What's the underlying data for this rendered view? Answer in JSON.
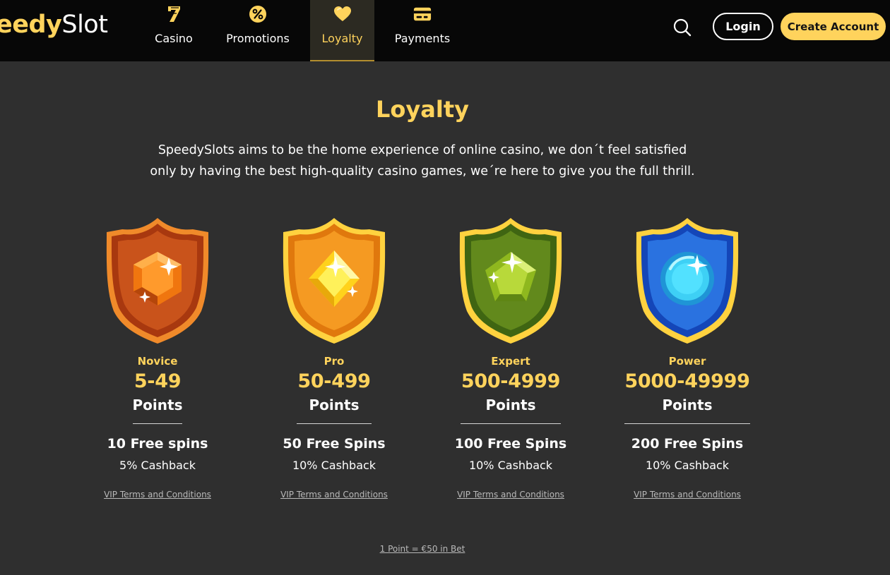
{
  "brand": {
    "logo_part1": "eedy",
    "logo_part2": "Slot"
  },
  "nav": [
    {
      "label": "Casino",
      "icon": "seven-icon"
    },
    {
      "label": "Promotions",
      "icon": "percent-icon"
    },
    {
      "label": "Loyalty",
      "icon": "heart-icon",
      "active": true
    },
    {
      "label": "Payments",
      "icon": "card-icon"
    }
  ],
  "header": {
    "login_label": "Login",
    "create_account_label": "Create Account"
  },
  "main": {
    "title": "Loyalty",
    "intro_line1": "SpeedySlots aims to be the home experience of online casino, we don´t feel satisfied",
    "intro_line2": "only by having the best high-quality casino games, we´re here to give you the full thrill."
  },
  "tiers": [
    {
      "name": "Novice",
      "range": "5-49",
      "unit": "Points",
      "spins": "10 Free spins",
      "cashback": "5% Cashback",
      "terms": "VIP Terms and Conditions",
      "icon": "bronze-shield-icon"
    },
    {
      "name": "Pro",
      "range": "50-499",
      "unit": "Points",
      "spins": "50 Free Spins",
      "cashback": "10% Cashback",
      "terms": "VIP Terms and Conditions",
      "icon": "gold-shield-icon"
    },
    {
      "name": "Expert",
      "range": "500-4999",
      "unit": "Points",
      "spins": "100 Free Spins",
      "cashback": "10% Cashback",
      "terms": "VIP Terms and Conditions",
      "icon": "emerald-shield-icon"
    },
    {
      "name": "Power",
      "range": "5000-49999",
      "unit": "Points",
      "spins": "200 Free Spins",
      "cashback": "10% Cashback",
      "terms": "VIP Terms and Conditions",
      "icon": "sapphire-shield-icon"
    }
  ],
  "footnote": "1 Point = €50 in Bet",
  "colors": {
    "accent": "#ffd35c",
    "background": "#2f2f2f",
    "header": "#070707"
  }
}
